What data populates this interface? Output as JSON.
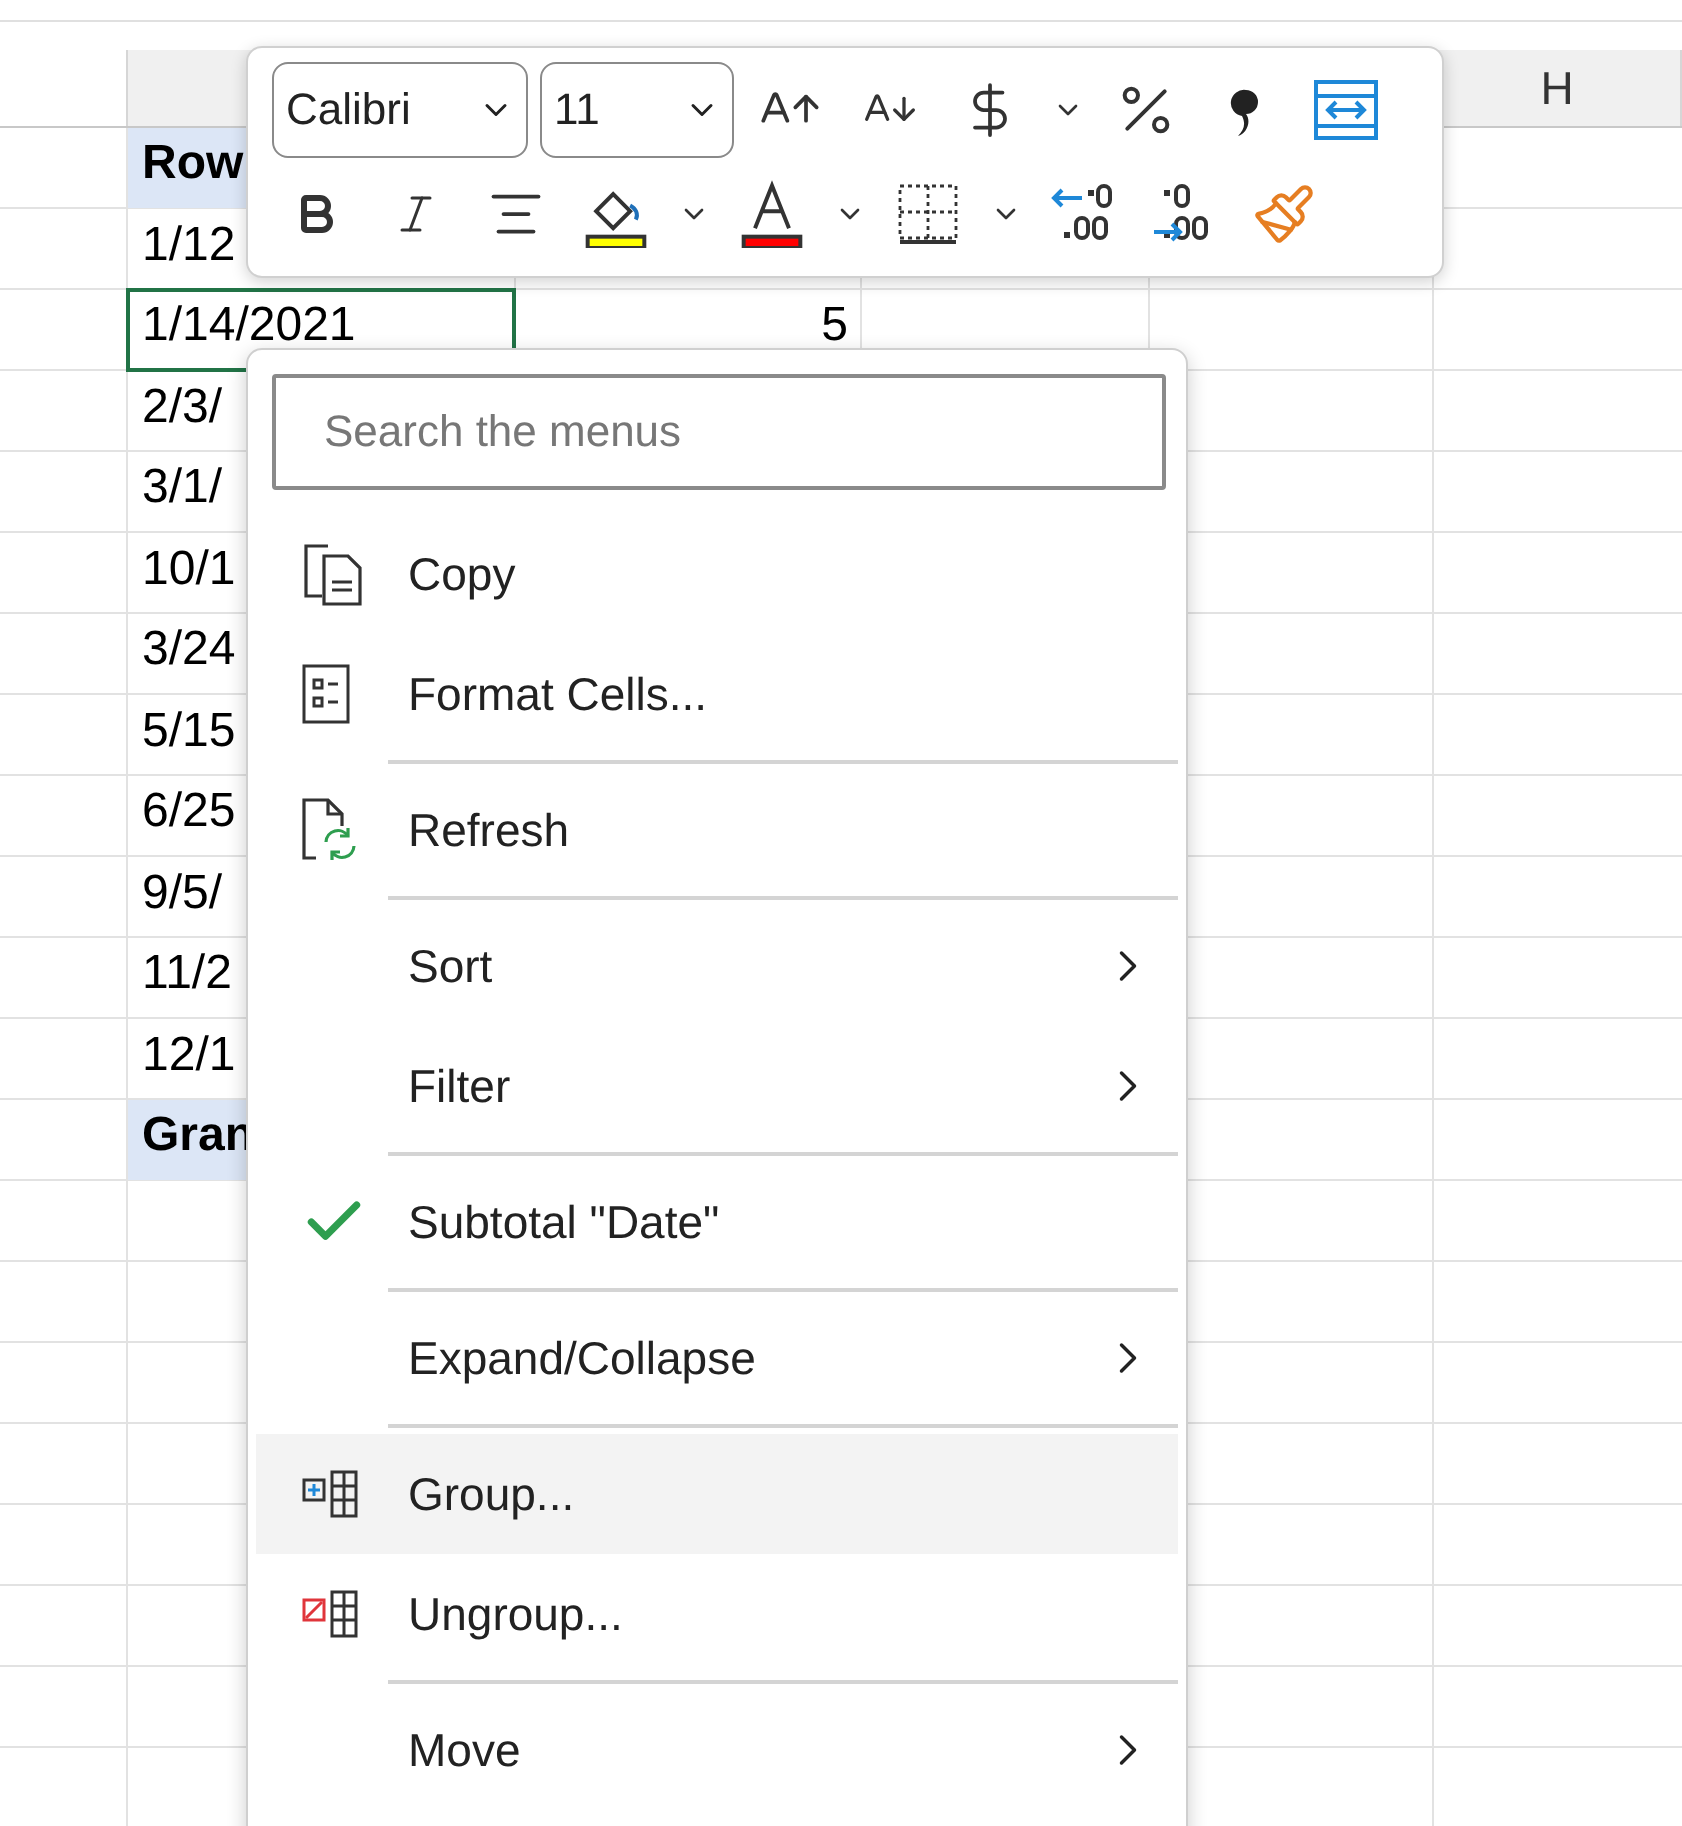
{
  "sheet": {
    "column_headers": [
      {
        "label": "H"
      }
    ],
    "rows": [
      {
        "kind": "header",
        "label": "Row",
        "selected": false
      },
      {
        "kind": "data",
        "label": "1/12",
        "selected": false
      },
      {
        "kind": "data",
        "label": "1/14/2021",
        "value": "5",
        "selected": true
      },
      {
        "kind": "data",
        "label": "2/3/",
        "selected": false
      },
      {
        "kind": "data",
        "label": "3/1/",
        "selected": false
      },
      {
        "kind": "data",
        "label": "10/1",
        "selected": false
      },
      {
        "kind": "data",
        "label": "3/24",
        "selected": false
      },
      {
        "kind": "data",
        "label": "5/15",
        "selected": false
      },
      {
        "kind": "data",
        "label": "6/25",
        "selected": false
      },
      {
        "kind": "data",
        "label": "9/5/",
        "selected": false
      },
      {
        "kind": "data",
        "label": "11/2",
        "selected": false
      },
      {
        "kind": "data",
        "label": "12/1",
        "selected": false
      },
      {
        "kind": "total",
        "label": "Gran",
        "selected": false
      }
    ]
  },
  "mini_toolbar": {
    "font": "Calibri",
    "size": "11"
  },
  "context_menu": {
    "search": {
      "placeholder": "Search the menus"
    },
    "items": [
      {
        "kind": "copy",
        "label": "Copy",
        "submenu": false,
        "checked": false,
        "selected": false
      },
      {
        "kind": "format",
        "label": "Format Cells...",
        "submenu": false,
        "checked": false,
        "selected": false
      },
      {
        "kind": "separator"
      },
      {
        "kind": "refresh",
        "label": "Refresh",
        "submenu": false,
        "checked": false,
        "selected": false
      },
      {
        "kind": "separator"
      },
      {
        "kind": "plain",
        "label": "Sort",
        "submenu": true,
        "checked": false,
        "selected": false
      },
      {
        "kind": "plain",
        "label": "Filter",
        "submenu": true,
        "checked": false,
        "selected": false
      },
      {
        "kind": "separator"
      },
      {
        "kind": "toggle",
        "label": "Subtotal \"Date\"",
        "submenu": false,
        "checked": true,
        "selected": false
      },
      {
        "kind": "separator"
      },
      {
        "kind": "plain",
        "label": "Expand/Collapse",
        "submenu": true,
        "checked": false,
        "selected": false
      },
      {
        "kind": "separator"
      },
      {
        "kind": "group",
        "label": "Group...",
        "submenu": false,
        "checked": false,
        "selected": true
      },
      {
        "kind": "ungroup",
        "label": "Ungroup...",
        "submenu": false,
        "checked": false,
        "selected": false
      },
      {
        "kind": "separator"
      },
      {
        "kind": "plain",
        "label": "Move",
        "submenu": true,
        "checked": false,
        "selected": false
      }
    ]
  }
}
